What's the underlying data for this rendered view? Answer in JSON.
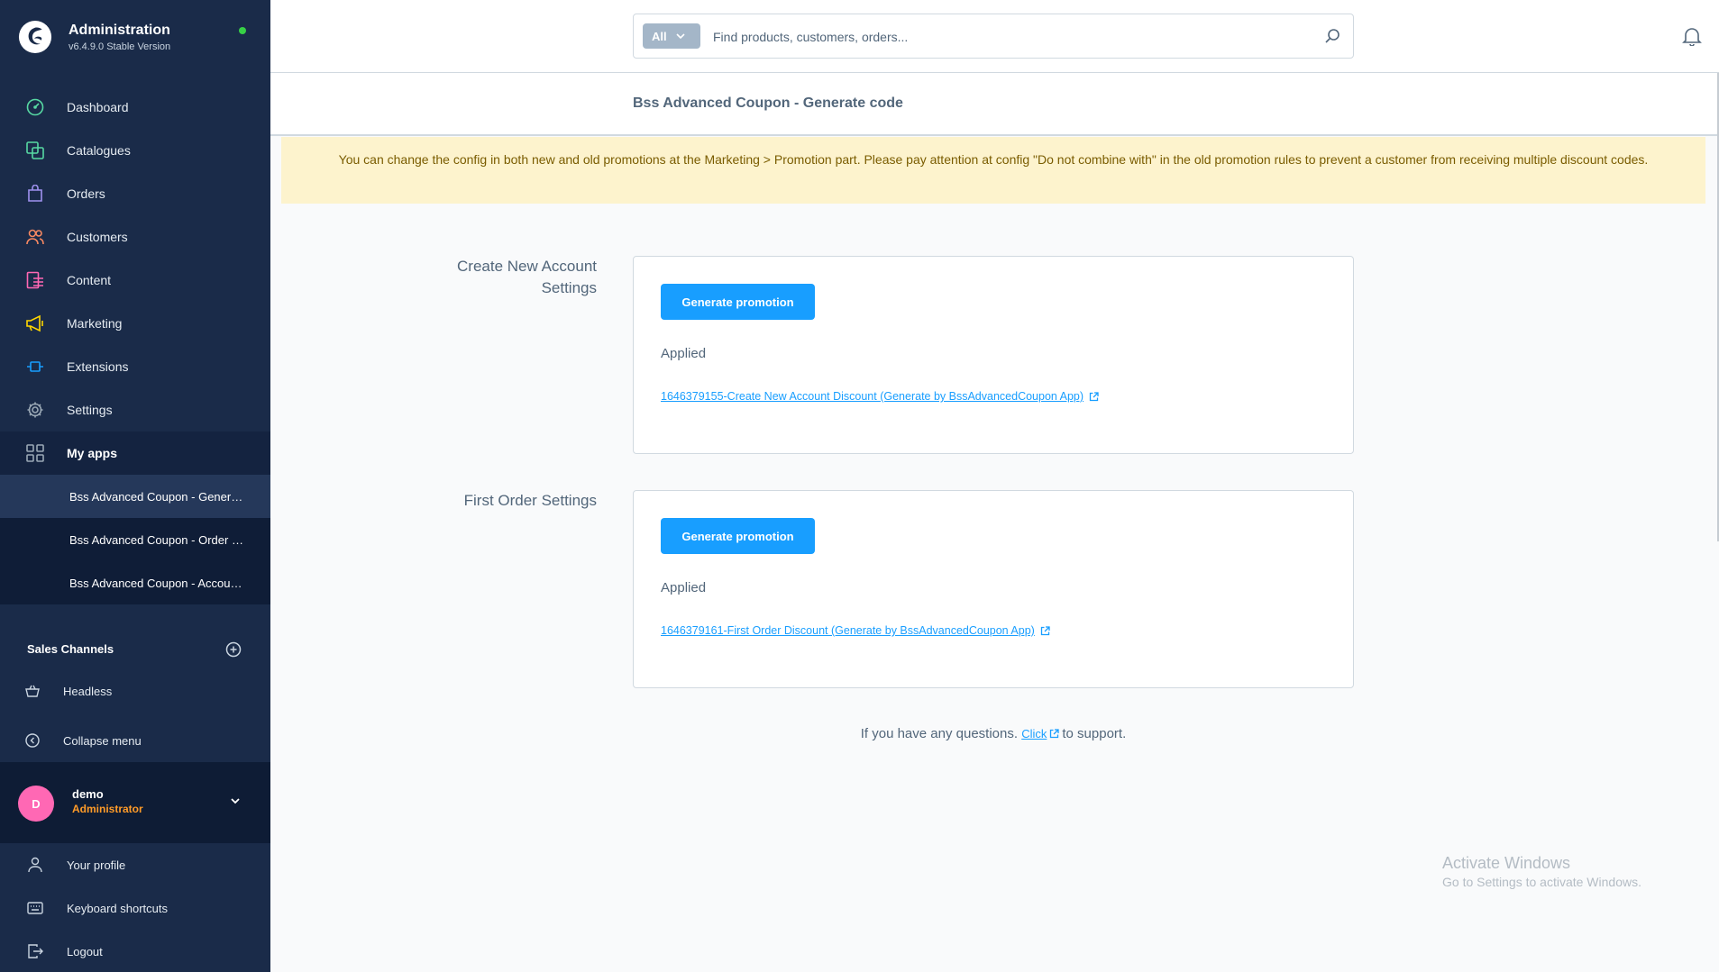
{
  "app": {
    "title": "Administration",
    "version": "v6.4.9.0 Stable Version",
    "status_color": "#37d046"
  },
  "sidebar": {
    "items": [
      {
        "label": "Dashboard",
        "icon": "dashboard-icon",
        "color": "#57d9a3"
      },
      {
        "label": "Catalogues",
        "icon": "catalogues-icon",
        "color": "#57d9a3"
      },
      {
        "label": "Orders",
        "icon": "orders-icon",
        "color": "#a092f0"
      },
      {
        "label": "Customers",
        "icon": "customers-icon",
        "color": "#f88962"
      },
      {
        "label": "Content",
        "icon": "content-icon",
        "color": "#ff68b4"
      },
      {
        "label": "Marketing",
        "icon": "marketing-icon",
        "color": "#ffd700"
      },
      {
        "label": "Extensions",
        "icon": "extensions-icon",
        "color": "#189eff"
      },
      {
        "label": "Settings",
        "icon": "settings-icon",
        "color": "#9aa8b5"
      },
      {
        "label": "My apps",
        "icon": "my-apps-icon",
        "color": "#9aa8b5"
      }
    ],
    "my_apps": [
      {
        "label": "Bss Advanced Coupon - Generate code",
        "active": true
      },
      {
        "label": "Bss Advanced Coupon - Order Discount",
        "active": false
      },
      {
        "label": "Bss Advanced Coupon - Account Discount",
        "active": false
      }
    ],
    "sales_channels": {
      "title": "Sales Channels",
      "items": [
        {
          "label": "Headless",
          "icon": "basket-icon"
        }
      ]
    },
    "collapse_label": "Collapse menu",
    "user": {
      "initial": "D",
      "name": "demo",
      "role": "Administrator"
    },
    "footer_items": [
      {
        "label": "Your profile",
        "icon": "user-icon"
      },
      {
        "label": "Keyboard shortcuts",
        "icon": "keyboard-icon"
      },
      {
        "label": "Logout",
        "icon": "logout-icon"
      }
    ]
  },
  "search": {
    "type_label": "All",
    "placeholder": "Find products, customers, orders..."
  },
  "page": {
    "title": "Bss Advanced Coupon - Generate code",
    "notice": "You can change the config in both new and old promotions at the Marketing > Promotion part. Please pay attention at config \"Do not combine with\" in the old promotion rules to prevent a customer from receiving multiple discount codes.",
    "sections": [
      {
        "label": "Create New Account Settings",
        "button": "Generate promotion",
        "status": "Applied",
        "link": "1646379155-Create New Account Discount (Generate by BssAdvancedCoupon App)"
      },
      {
        "label": "First Order Settings",
        "button": "Generate promotion",
        "status": "Applied",
        "link": "1646379161-First Order Discount (Generate by BssAdvancedCoupon App)"
      }
    ],
    "support": {
      "prefix": "If you have any questions.",
      "link": "Click",
      "suffix": "to support."
    }
  },
  "watermark": {
    "line1": "Activate Windows",
    "line2": "Go to Settings to activate Windows."
  },
  "colors": {
    "sidebar_bg": "#1a2b49",
    "primary": "#189eff",
    "notice_bg": "#fdf3cd"
  }
}
